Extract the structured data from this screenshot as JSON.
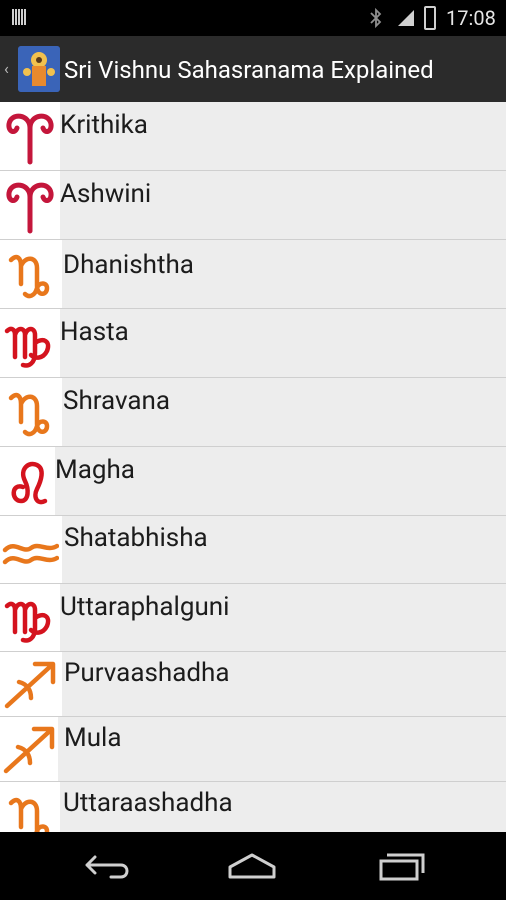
{
  "status_bar": {
    "time": "17:08"
  },
  "action_bar": {
    "title": "Sri Vishnu Sahasranama Explained",
    "up_indicator": "‹"
  },
  "list": {
    "items": [
      {
        "label": "Krithika",
        "icon": "aries-icon",
        "color": "#c4163b"
      },
      {
        "label": "Ashwini",
        "icon": "aries-icon",
        "color": "#c4163b"
      },
      {
        "label": "Dhanishtha",
        "icon": "capricorn-icon",
        "color": "#e8771c"
      },
      {
        "label": "Hasta",
        "icon": "virgo-icon",
        "color": "#d4131e"
      },
      {
        "label": "Shravana",
        "icon": "capricorn-icon",
        "color": "#e8771c"
      },
      {
        "label": "Magha",
        "icon": "leo-icon",
        "color": "#d4131e"
      },
      {
        "label": "Shatabhisha",
        "icon": "aquarius-icon",
        "color": "#e8771c"
      },
      {
        "label": "Uttaraphalguni",
        "icon": "virgo-icon",
        "color": "#d4131e"
      },
      {
        "label": "Purvaashadha",
        "icon": "sagittarius-icon",
        "color": "#e8771c"
      },
      {
        "label": "Mula",
        "icon": "sagittarius-icon",
        "color": "#e8771c"
      },
      {
        "label": "Uttaraashadha",
        "icon": "capricorn-icon",
        "color": "#e8771c"
      }
    ]
  },
  "nav_bar": {
    "buttons": [
      "back-icon",
      "home-icon",
      "recents-icon"
    ]
  }
}
